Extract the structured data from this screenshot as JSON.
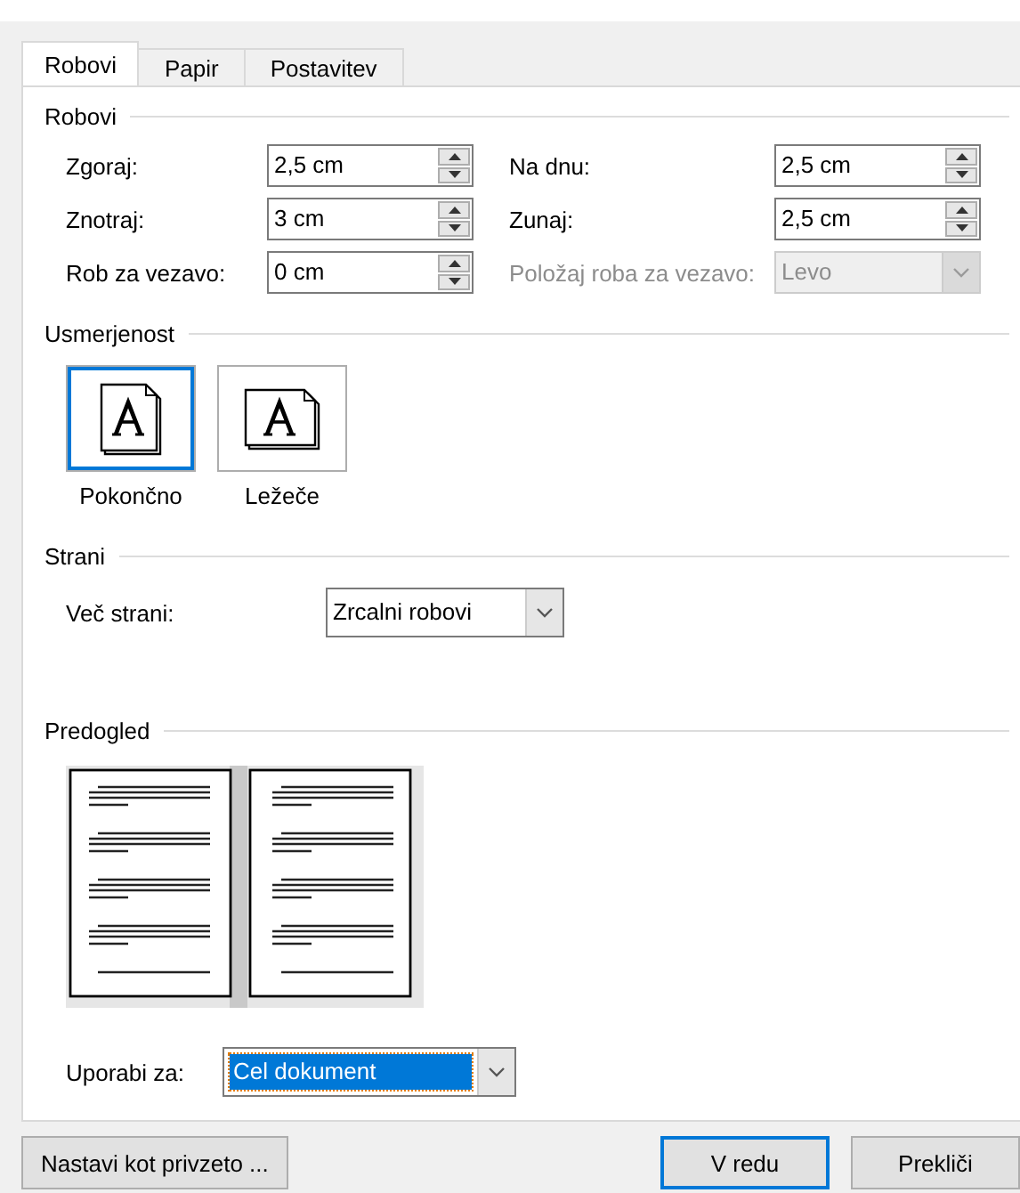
{
  "tabs": [
    {
      "label": "Robovi",
      "selected": true
    },
    {
      "label": "Papir",
      "selected": false
    },
    {
      "label": "Postavitev",
      "selected": false
    }
  ],
  "margins": {
    "title": "Robovi",
    "rows": [
      {
        "left": {
          "kind": "spinner",
          "label": "Zgoraj:",
          "value": "2,5 cm",
          "disabled": false
        },
        "right": {
          "kind": "spinner",
          "label": "Na dnu:",
          "value": "2,5 cm",
          "disabled": false
        }
      },
      {
        "left": {
          "kind": "spinner",
          "label": "Znotraj:",
          "value": "3 cm",
          "disabled": false
        },
        "right": {
          "kind": "spinner",
          "label": "Zunaj:",
          "value": "2,5 cm",
          "disabled": false
        }
      },
      {
        "left": {
          "kind": "spinner",
          "label": "Rob za vezavo:",
          "value": "0 cm",
          "disabled": false
        },
        "right": {
          "kind": "dropdown",
          "label": "Položaj roba za vezavo:",
          "value": "Levo",
          "disabled": true
        }
      }
    ]
  },
  "orientation": {
    "title": "Usmerjenost",
    "options": [
      {
        "label": "Pokončno",
        "kind": "portrait",
        "selected": true
      },
      {
        "label": "Ležeče",
        "kind": "landscape",
        "selected": false
      }
    ]
  },
  "pages": {
    "title": "Strani",
    "label": "Več strani:",
    "value": "Zrcalni robovi"
  },
  "preview": {
    "title": "Predogled"
  },
  "apply_to": {
    "label": "Uporabi za:",
    "value": "Cel dokument",
    "focused": true
  },
  "left_buttons": [
    {
      "label": "Nastavi kot privzeto ...",
      "default": false
    }
  ],
  "right_buttons": [
    {
      "label": "V redu",
      "default": true
    },
    {
      "label": "Prekliči",
      "default": false
    }
  ]
}
